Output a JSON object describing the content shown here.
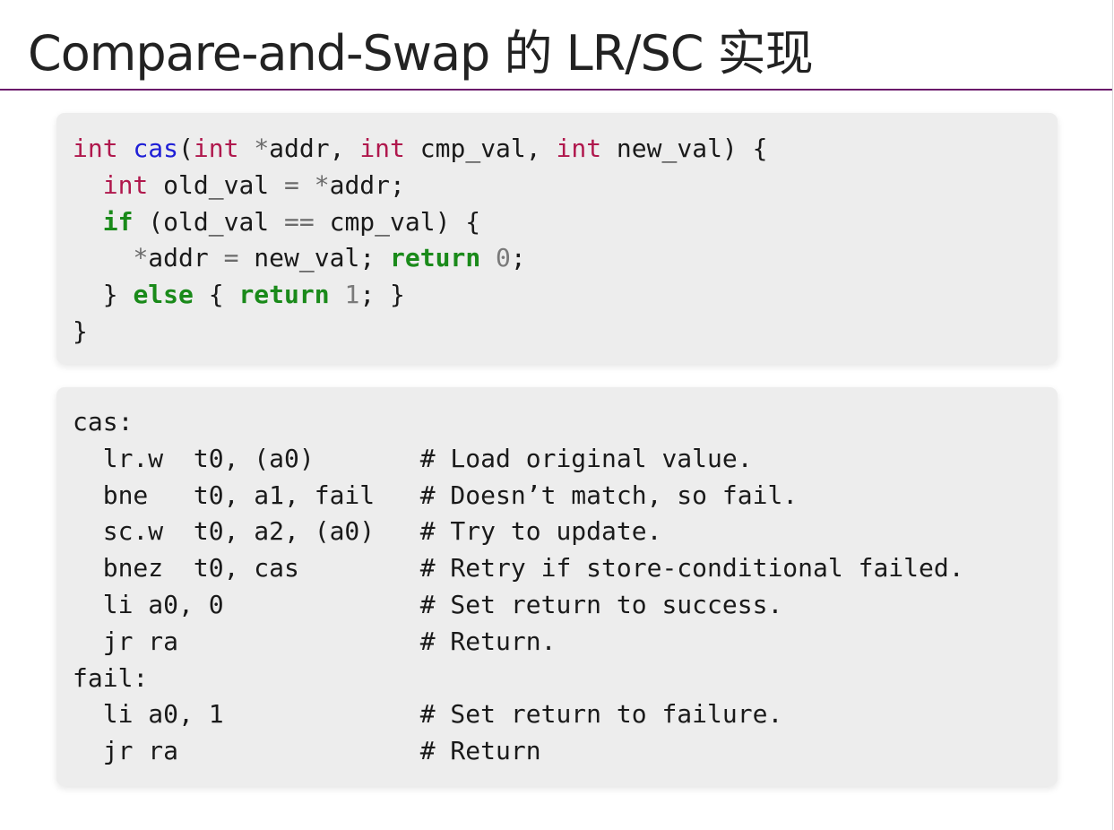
{
  "slide": {
    "title": "Compare-and-Swap 的 LR/SC 实现"
  },
  "c_code": {
    "lines": [
      [
        {
          "t": "int",
          "k": "type"
        },
        {
          "t": " "
        },
        {
          "t": "cas",
          "k": "fn"
        },
        {
          "t": "("
        },
        {
          "t": "int",
          "k": "type"
        },
        {
          "t": " "
        },
        {
          "t": "*",
          "k": "op"
        },
        {
          "t": "addr, "
        },
        {
          "t": "int",
          "k": "type"
        },
        {
          "t": " cmp_val, "
        },
        {
          "t": "int",
          "k": "type"
        },
        {
          "t": " new_val) {"
        }
      ],
      [
        {
          "t": "  "
        },
        {
          "t": "int",
          "k": "type"
        },
        {
          "t": " old_val "
        },
        {
          "t": "=",
          "k": "op"
        },
        {
          "t": " "
        },
        {
          "t": "*",
          "k": "op"
        },
        {
          "t": "addr;"
        }
      ],
      [
        {
          "t": "  "
        },
        {
          "t": "if",
          "k": "ctl"
        },
        {
          "t": " (old_val "
        },
        {
          "t": "==",
          "k": "op"
        },
        {
          "t": " cmp_val) {"
        }
      ],
      [
        {
          "t": "    "
        },
        {
          "t": "*",
          "k": "op"
        },
        {
          "t": "addr "
        },
        {
          "t": "=",
          "k": "op"
        },
        {
          "t": " new_val; "
        },
        {
          "t": "return",
          "k": "ctl"
        },
        {
          "t": " "
        },
        {
          "t": "0",
          "k": "num"
        },
        {
          "t": ";"
        }
      ],
      [
        {
          "t": "  } "
        },
        {
          "t": "else",
          "k": "ctl"
        },
        {
          "t": " { "
        },
        {
          "t": "return",
          "k": "ctl"
        },
        {
          "t": " "
        },
        {
          "t": "1",
          "k": "num"
        },
        {
          "t": "; }"
        }
      ],
      [
        {
          "t": "}"
        }
      ]
    ]
  },
  "asm_code": {
    "lines": [
      "cas:",
      "  lr.w  t0, (a0)       # Load original value.",
      "  bne   t0, a1, fail   # Doesn’t match, so fail.",
      "  sc.w  t0, a2, (a0)   # Try to update.",
      "  bnez  t0, cas        # Retry if store-conditional failed.",
      "  li a0, 0             # Set return to success.",
      "  jr ra                # Return.",
      "fail:",
      "  li a0, 1             # Set return to failure.",
      "  jr ra                # Return"
    ]
  },
  "colors": {
    "accent_rule": "#6b1a6b",
    "code_bg": "#ededed",
    "type_keyword": "#b0184d",
    "function_name": "#1f1fd6",
    "control_keyword": "#1a8a1a"
  }
}
